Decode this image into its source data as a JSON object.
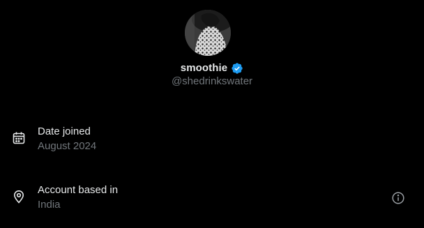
{
  "profile": {
    "display_name": "smoothie",
    "handle": "@shedrinkswater",
    "verified": true,
    "verified_color": "#1d9bf0",
    "avatar_icon": "avatar-photo"
  },
  "about": {
    "date_joined": {
      "icon": "calendar-icon",
      "label": "Date joined",
      "value": "August 2024"
    },
    "account_location": {
      "icon": "location-pin-icon",
      "label": "Account based in",
      "value": "India",
      "info_icon": "info-icon"
    }
  },
  "colors": {
    "background": "#000000",
    "primary_text": "#e7e9ea",
    "secondary_text": "#71767b"
  }
}
